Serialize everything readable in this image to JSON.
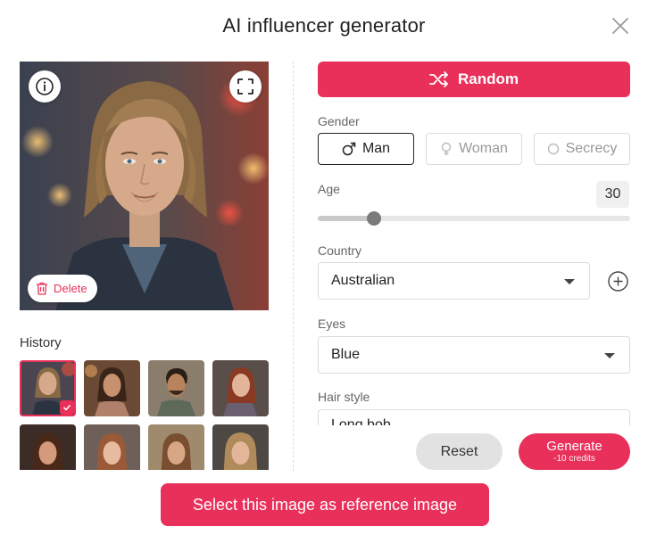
{
  "dialog": {
    "title": "AI influencer generator"
  },
  "preview": {
    "delete_label": "Delete"
  },
  "history": {
    "label": "History",
    "thumbnails": [
      {
        "selected": true
      },
      {
        "selected": false
      },
      {
        "selected": false
      },
      {
        "selected": false
      },
      {
        "selected": false
      },
      {
        "selected": false
      },
      {
        "selected": false
      },
      {
        "selected": false
      }
    ]
  },
  "controls": {
    "random_label": "Random",
    "gender": {
      "label": "Gender",
      "options": [
        "Man",
        "Woman",
        "Secrecy"
      ],
      "selected": "Man"
    },
    "age": {
      "label": "Age",
      "value": "30",
      "slider_fraction": 0.18
    },
    "country": {
      "label": "Country",
      "value": "Australian"
    },
    "eyes": {
      "label": "Eyes",
      "value": "Blue"
    },
    "hair_style": {
      "label": "Hair style",
      "value": "Long bob"
    }
  },
  "footer": {
    "reset_label": "Reset",
    "generate_label": "Generate",
    "generate_cost": "-10 credits",
    "select_reference_label": "Select this image as reference image"
  },
  "colors": {
    "accent": "#e8305a",
    "text": "#222222",
    "muted": "#666666"
  },
  "icons": [
    "close-icon",
    "info-icon",
    "fullscreen-icon",
    "trash-icon",
    "shuffle-icon",
    "male-icon",
    "female-icon",
    "circle-icon",
    "plus-circle-icon",
    "check-icon"
  ]
}
